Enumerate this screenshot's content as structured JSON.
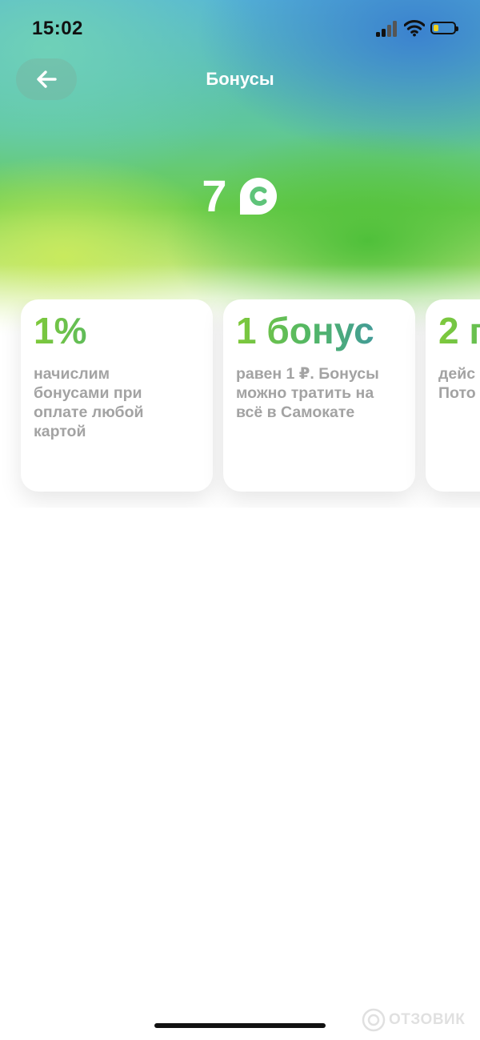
{
  "status_bar": {
    "time": "15:02"
  },
  "header": {
    "title": "Бонусы"
  },
  "balance": {
    "value": "7"
  },
  "cards": [
    {
      "heading": "1%",
      "text": "начислим\nбонусами при\nоплате любой\nкартой"
    },
    {
      "heading": "1 бонус",
      "text": "равен 1 ₽. Бонусы\nможно тратить на\nвсё в Самокате"
    },
    {
      "heading": "2 п",
      "text": "дейс\nПото"
    }
  ],
  "watermark": {
    "text": "ОТЗОВИК"
  },
  "colors": {
    "accent_green": "#52b766",
    "accent_teal": "#3c8fae",
    "text_gray": "#a3a3a3"
  }
}
